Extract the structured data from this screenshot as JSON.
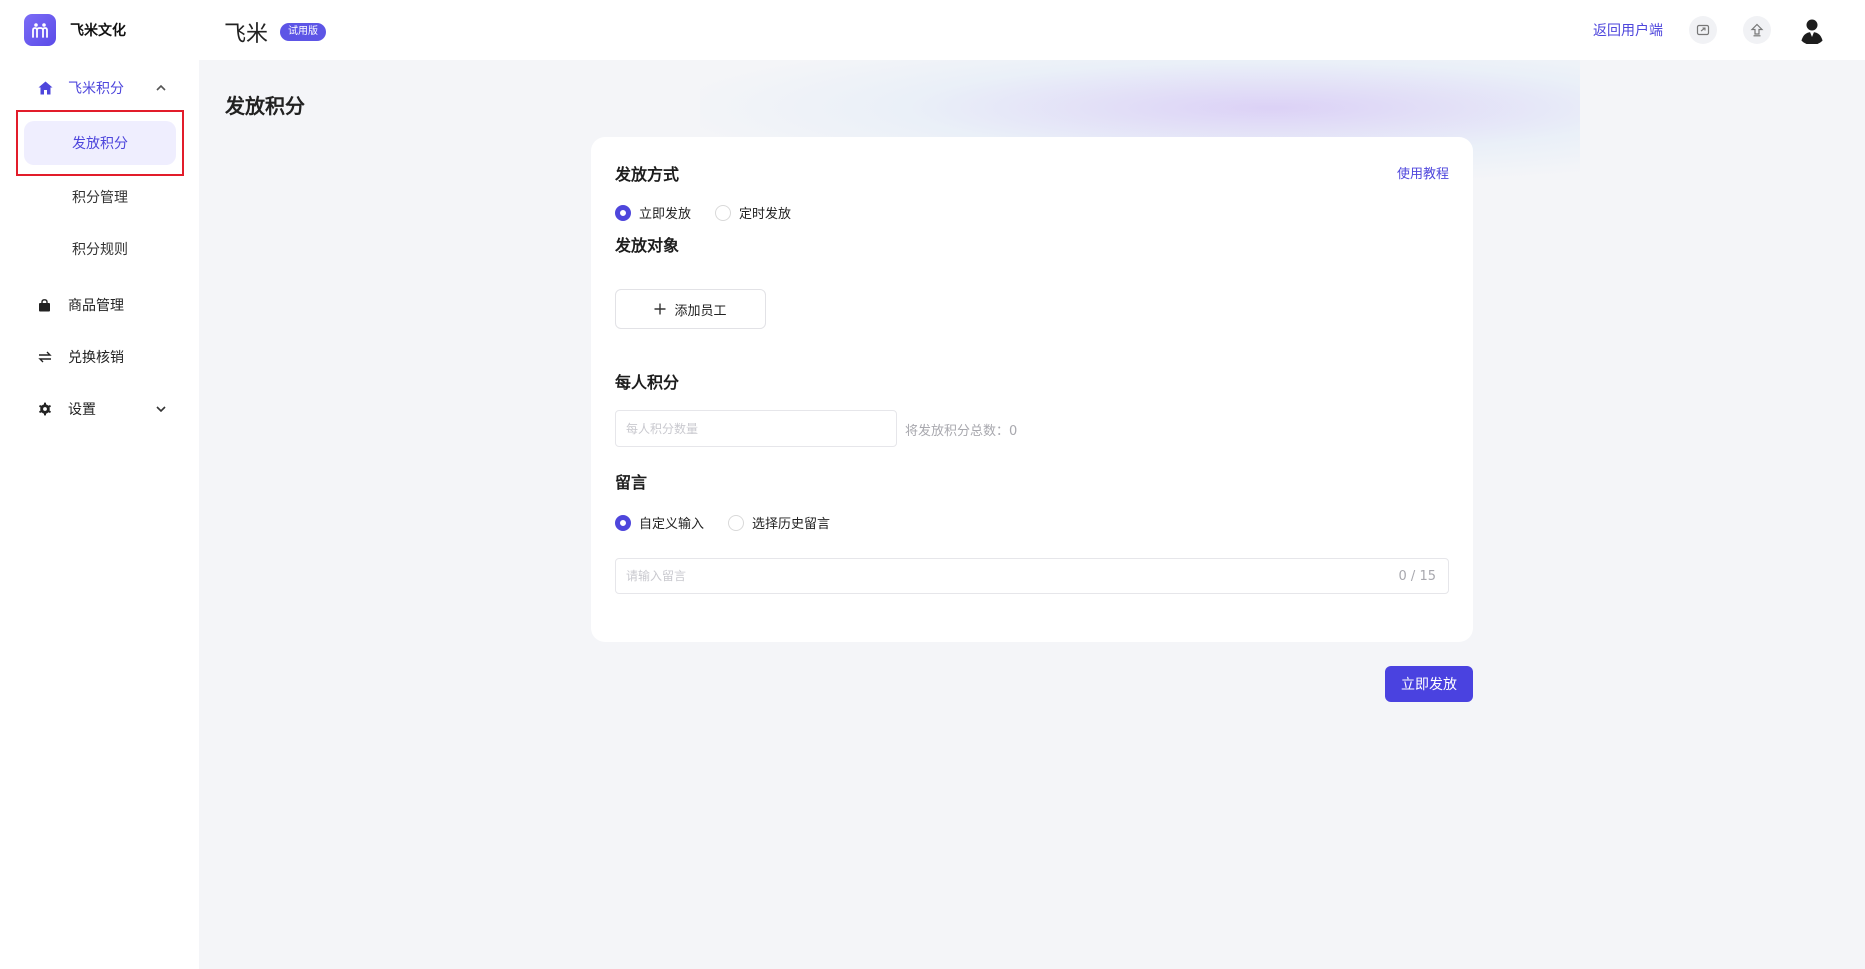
{
  "brand": {
    "name": "飞米文化"
  },
  "sidebar": {
    "groups": [
      {
        "label": "飞米积分",
        "icon": "home-icon",
        "expanded": true
      },
      {
        "label": "商品管理",
        "icon": "bag-icon"
      },
      {
        "label": "兑换核销",
        "icon": "exchange-icon"
      },
      {
        "label": "设置",
        "icon": "gear-icon",
        "expanded": false
      }
    ],
    "sub_items": [
      "发放积分",
      "积分管理",
      "积分规则"
    ]
  },
  "header": {
    "app_name": "飞米",
    "badge": "试用版",
    "return_label": "返回用户端"
  },
  "page": {
    "title": "发放积分"
  },
  "form": {
    "method_title": "发放方式",
    "tutorial_label": "使用教程",
    "method_options": [
      "立即发放",
      "定时发放"
    ],
    "target_title": "发放对象",
    "add_employee_label": "添加员工",
    "per_person_title": "每人积分",
    "per_person_placeholder": "每人积分数量",
    "total_label": "将发放积分总数：0",
    "message_title": "留言",
    "message_options": [
      "自定义输入",
      "选择历史留言"
    ],
    "message_placeholder": "请输入留言",
    "char_count": "0 / 15",
    "submit_label": "立即发放"
  },
  "colors": {
    "accent": "#4e46dc",
    "highlight": "#e21c2a"
  }
}
